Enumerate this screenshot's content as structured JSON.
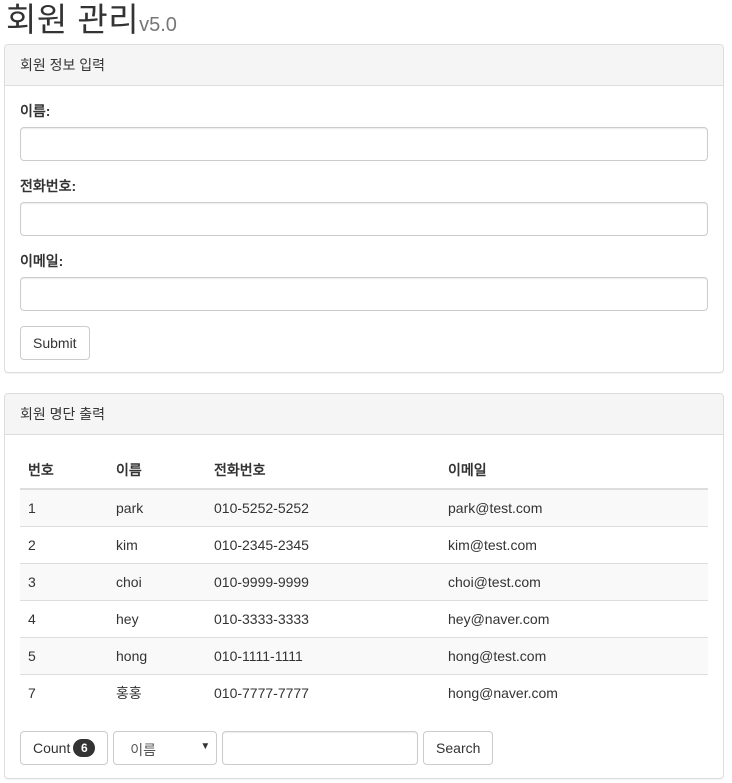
{
  "header": {
    "title": "회원 관리",
    "version": "v5.0"
  },
  "input_panel": {
    "heading": "회원 정보 입력",
    "fields": [
      {
        "label": "이름:",
        "value": ""
      },
      {
        "label": "전화번호:",
        "value": ""
      },
      {
        "label": "이메일:",
        "value": ""
      }
    ],
    "submit_label": "Submit"
  },
  "list_panel": {
    "heading": "회원 명단 출력",
    "columns": [
      "번호",
      "이름",
      "전화번호",
      "이메일"
    ],
    "rows": [
      [
        "1",
        "park",
        "010-5252-5252",
        "park@test.com"
      ],
      [
        "2",
        "kim",
        "010-2345-2345",
        "kim@test.com"
      ],
      [
        "3",
        "choi",
        "010-9999-9999",
        "choi@test.com"
      ],
      [
        "4",
        "hey",
        "010-3333-3333",
        "hey@naver.com"
      ],
      [
        "5",
        "hong",
        "010-1111-1111",
        "hong@test.com"
      ],
      [
        "7",
        "홍홍",
        "010-7777-7777",
        "hong@naver.com"
      ]
    ],
    "count_label": "Count",
    "count_value": "6",
    "search_field_selected": "이름",
    "search_value": "",
    "search_label": "Search"
  }
}
